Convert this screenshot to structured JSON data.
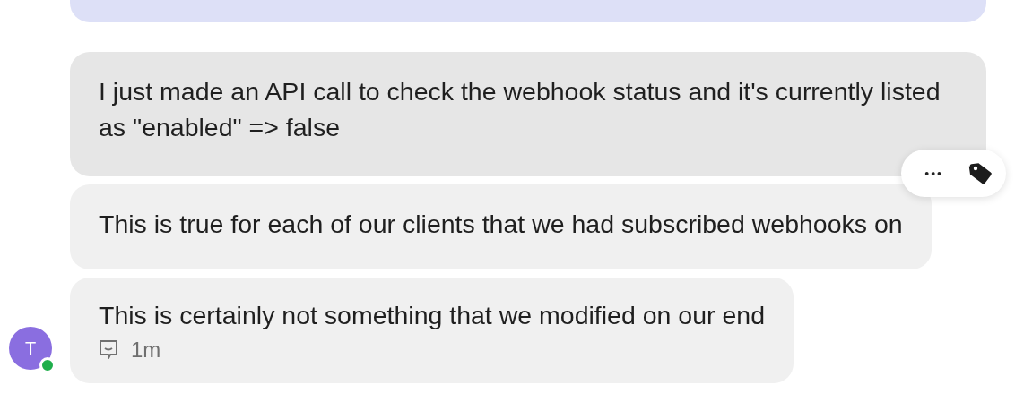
{
  "messages": [
    {
      "text": "I just made an API call to check the webhook status and it's currently listed as \"enabled\" => false",
      "hovered": true
    },
    {
      "text": "This is true for each of our clients that we had subscribed webhooks on",
      "hovered": false
    },
    {
      "text": "This is certainly not something that we modified on our end",
      "hovered": false,
      "time": "1m"
    }
  ],
  "actions": {
    "more": "•••"
  },
  "author": {
    "initial": "T",
    "online": true
  }
}
